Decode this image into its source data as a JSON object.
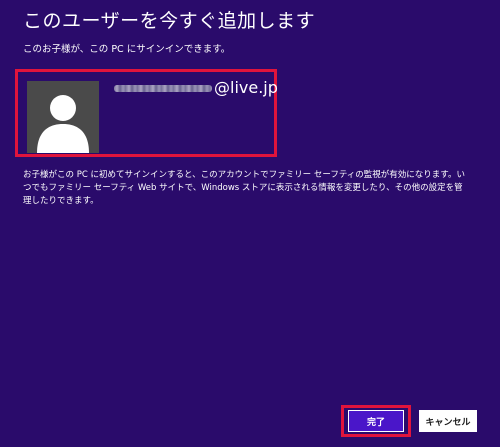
{
  "header": {
    "title": "このユーザーを今すぐ追加します",
    "subtitle": "このお子様が、この PC にサインインできます。"
  },
  "account": {
    "email_domain": "@live.jp",
    "avatar_icon": "user-silhouette-icon"
  },
  "info_text": "お子様がこの PC に初めてサインインすると、このアカウントでファミリー セーフティの監視が有効になります。いつでもファミリー セーフティ Web サイトで、Windows ストアに表示される情報を変更したり、その他の設定を管理したりできます。",
  "buttons": {
    "finish": "完了",
    "cancel": "キャンセル"
  },
  "colors": {
    "background": "#2a0b6b",
    "highlight": "#e0143c",
    "primary_button": "#4a16c9",
    "avatar_bg": "#4a4a4a"
  }
}
